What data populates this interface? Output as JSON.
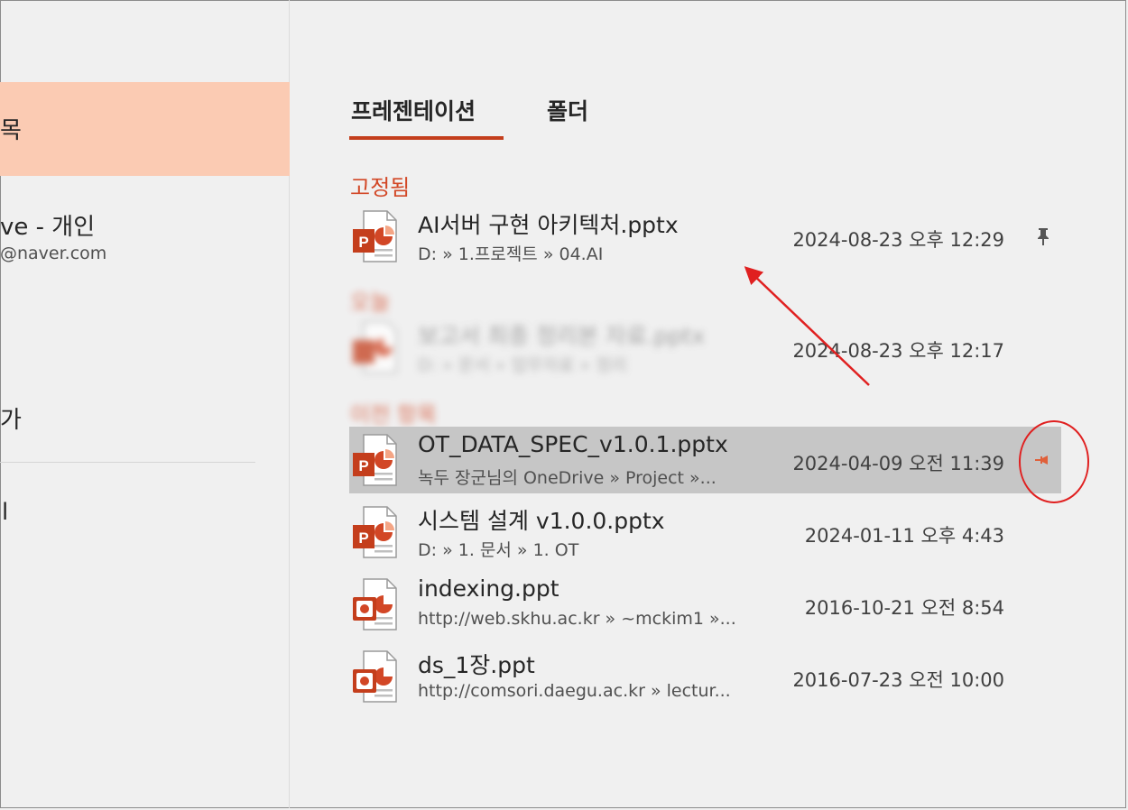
{
  "sidebar": {
    "selected_label": "목",
    "account_title": "ve - 개인",
    "account_email": "@naver.com",
    "item_add": "가",
    "item_bottom": "l"
  },
  "tabs": [
    {
      "label": "프레젠테이션",
      "active": true
    },
    {
      "label": "폴더",
      "active": false
    }
  ],
  "sections": {
    "pinned": "고정됨",
    "today": "오늘",
    "older": "이전 항목"
  },
  "files": {
    "pinned": [
      {
        "name": "AI서버 구현 아키텍처.pptx",
        "path": "D: » 1.프로젝트 » 04.AI",
        "date": "2024-08-23 오후 12:29",
        "icon": "pptx-icon",
        "pinned": true
      }
    ],
    "today": [
      {
        "name": "보고서 최종 정리본 자료.pptx",
        "path": "D: » 문서 » 업무자료 » 정리",
        "date": "2024-08-23 오후 12:17",
        "icon": "pptx-icon",
        "blurred": true
      }
    ],
    "older": [
      {
        "name": "OT_DATA_SPEC_v1.0.1.pptx",
        "path": "녹두 장군님의 OneDrive » Project »...",
        "date": "2024-04-09 오전 11:39",
        "icon": "pptx-icon",
        "selected": true,
        "pin_hover": true
      },
      {
        "name": "시스템 설계 v1.0.0.pptx",
        "path": "D: » 1. 문서 » 1. OT",
        "date": "2024-01-11 오후 4:43",
        "icon": "pptx-icon"
      },
      {
        "name": "indexing.ppt",
        "path": "http://web.skhu.ac.kr » ~mckim1 »...",
        "date": "2016-10-21 오전 8:54",
        "icon": "ppt-icon"
      },
      {
        "name": "ds_1장.ppt",
        "path": "http://comsori.daegu.ac.kr » lectur...",
        "date": "2016-07-23 오전 10:00",
        "icon": "ppt-icon"
      }
    ]
  },
  "colors": {
    "accent": "#c43e1c",
    "section_heading": "#d24726",
    "sidebar_selected": "#fbcbb3",
    "row_selected": "#c6c6c6",
    "annotation": "#e02020"
  }
}
